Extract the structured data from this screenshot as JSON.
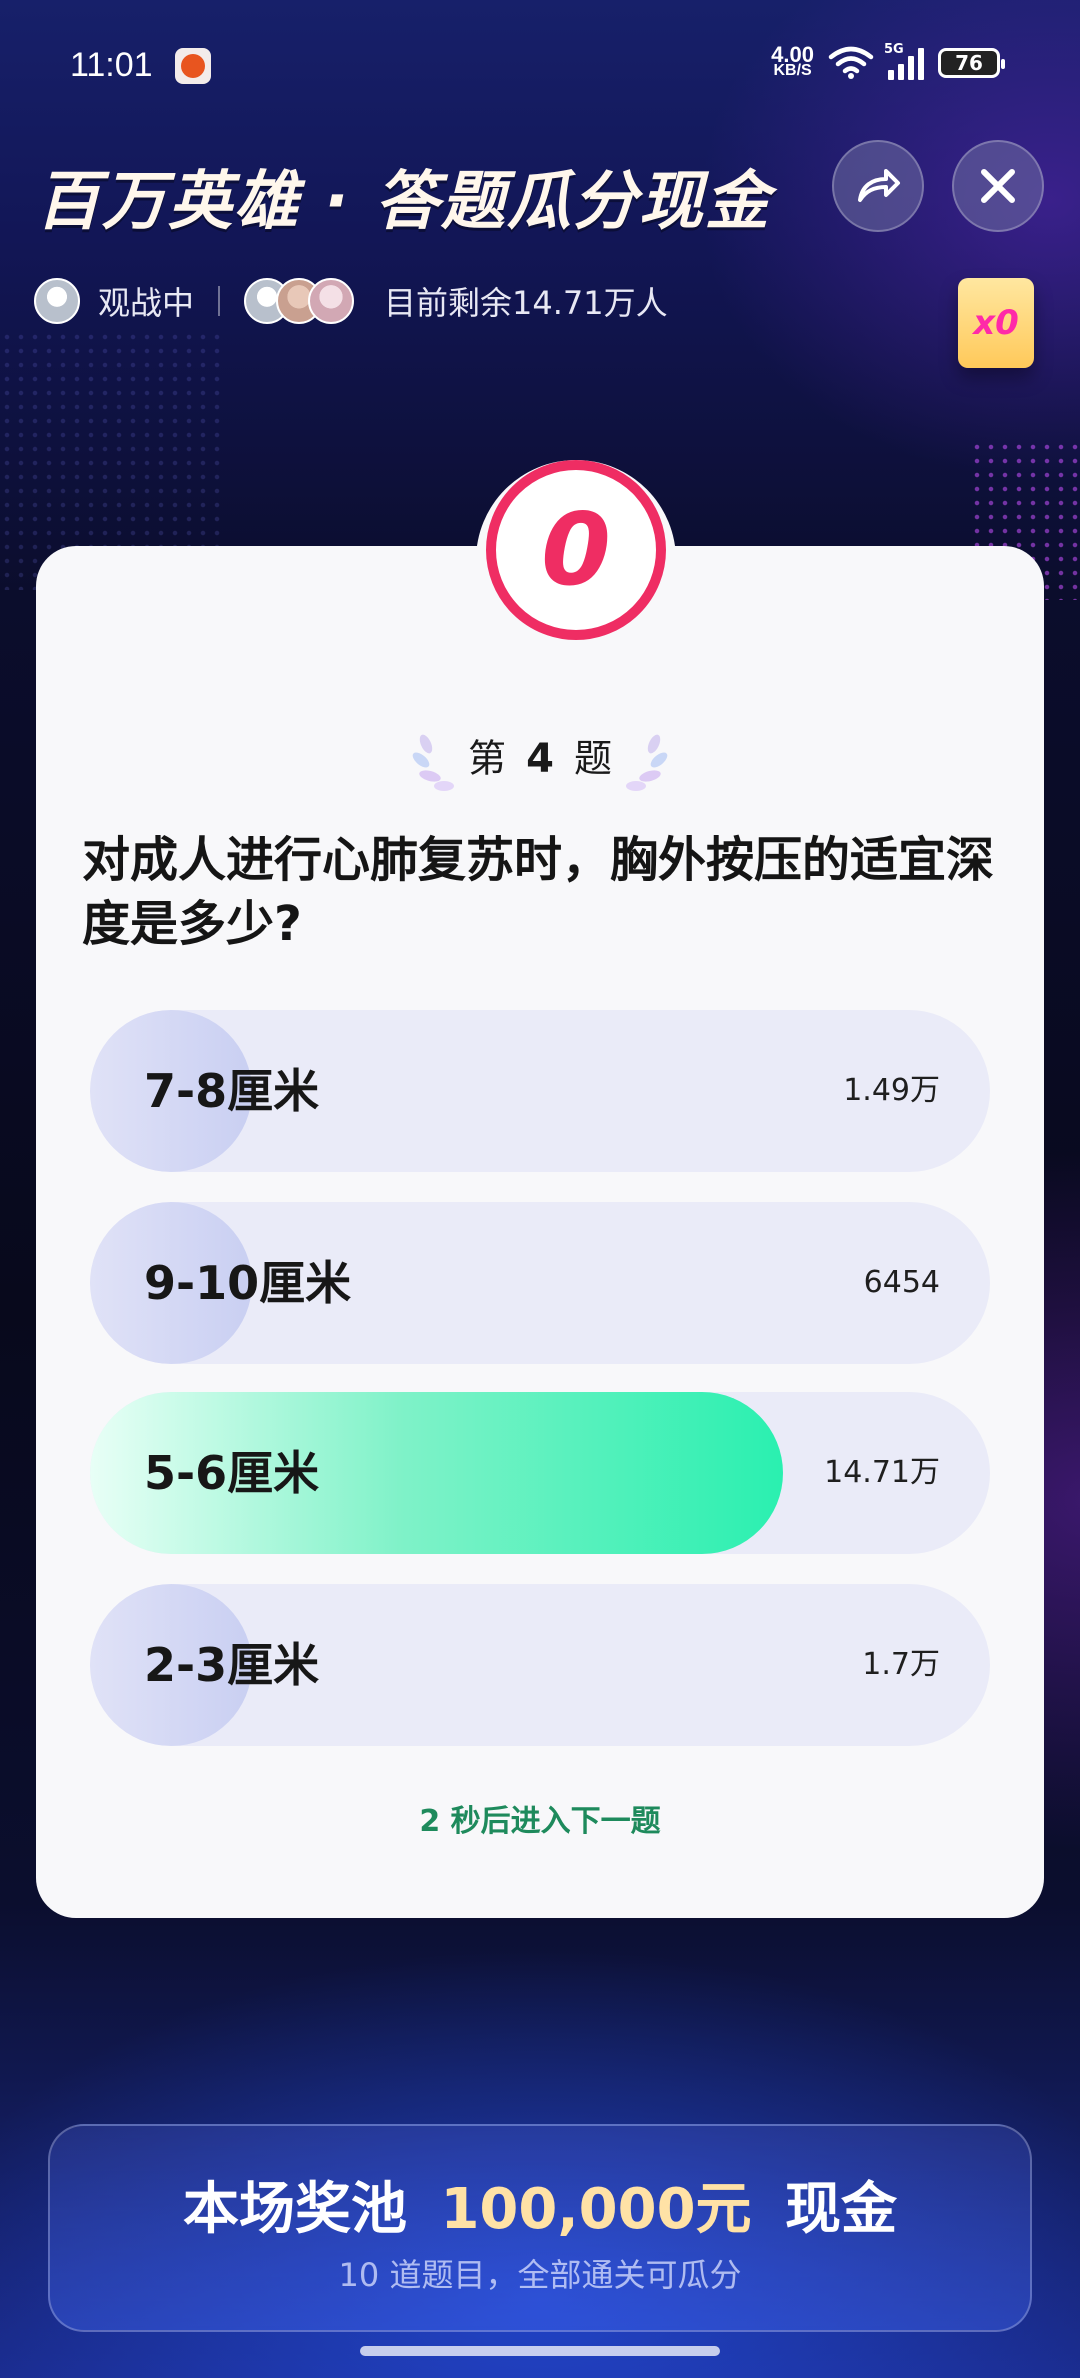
{
  "status_bar": {
    "time": "11:01",
    "net_speed_value": "4.00",
    "net_speed_unit": "KB/S",
    "network_type": "5G",
    "battery": "76"
  },
  "header": {
    "title": "百万英雄 · 答题瓜分现金",
    "share_icon": "share-arrow-icon",
    "close_icon": "close-icon"
  },
  "viewers": {
    "watching_label": "观战中",
    "remaining_label": "目前剩余",
    "remaining_count": "14.71万",
    "remaining_unit": "人"
  },
  "revive_card": {
    "label": "x0",
    "color": "#ff2aa8"
  },
  "quiz": {
    "timer": "0",
    "question_prefix": "第",
    "question_number": "4",
    "question_suffix": "题",
    "question": "对成人进行心肺复苏时，胸外按压的适宜深度是多少?",
    "options": [
      {
        "label": "7-8厘米",
        "count": "1.49万",
        "share": 0.09,
        "correct": false
      },
      {
        "label": "9-10厘米",
        "count": "6454",
        "share": 0.04,
        "correct": false
      },
      {
        "label": "5-6厘米",
        "count": "14.71万",
        "share": 0.77,
        "correct": true
      },
      {
        "label": "2-3厘米",
        "count": "1.7万",
        "share": 0.1,
        "correct": false
      }
    ],
    "next_seconds": "2",
    "next_hint": "秒后进入下一题",
    "accent_color": "#ef2d63",
    "correct_color": "#2af0b0"
  },
  "prize": {
    "prefix": "本场奖池",
    "amount": "100,000元",
    "suffix": "现金",
    "subtitle": "10 道题目，全部通关可瓜分"
  }
}
